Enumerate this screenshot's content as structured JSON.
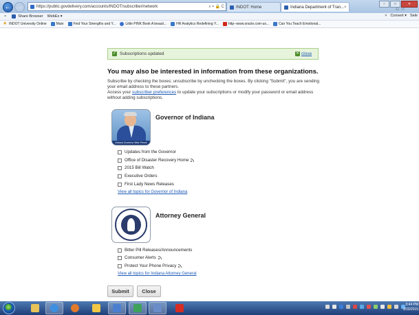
{
  "browser": {
    "url": "https://public.govdelivery.com/accounts/INDOT/subscriber/network",
    "url_controls": "⌕ ▾ 🔒 C",
    "tabs": [
      {
        "label": "INDOT: Home",
        "active": false
      },
      {
        "label": "Indiana Department of Tran...",
        "active": true
      }
    ],
    "tab_close": "×"
  },
  "command_bar": {
    "close": "×",
    "items": [
      "Share Browser",
      "WebEx ▾"
    ],
    "right_items": [
      "×",
      "Convert ▾",
      "Sele"
    ]
  },
  "favorites": [
    {
      "label": "INDOT University Online",
      "icon": "star"
    },
    {
      "label": "Main",
      "icon": "ie"
    },
    {
      "label": "Find Your Strengths and Y...",
      "icon": "ie"
    },
    {
      "label": "Little PINK Book  A beauti...",
      "icon": "pink"
    },
    {
      "label": "HR Analytics Redefining Y...",
      "icon": "ie"
    },
    {
      "label": "http--www.oracle.com-us...",
      "icon": "oracle"
    },
    {
      "label": "Can You Teach Emotional...",
      "icon": "ie"
    }
  ],
  "alert": {
    "message": "Subscriptions updated",
    "close_label": "close"
  },
  "heading": "You may also be interested in information from these organizations.",
  "intro": {
    "line1": "Subscribe by checking the boxes; unsubscribe by unchecking the boxes. By clicking \"Submit\", you are sending your email address to these partners.",
    "line2_pre": "Access your ",
    "line2_link": "subscriber preferences",
    "line2_post": " to update your subscriptions or modify your password or email address without adding subscriptions."
  },
  "organizations": [
    {
      "name": "Governor of Indiana",
      "logo_caption": "Indiana Governor Mike Pence",
      "topics": [
        {
          "label": "Updates from the Governor",
          "rss": false
        },
        {
          "label": "Office of Disaster Recovery Home",
          "rss": true
        },
        {
          "label": "2015 Bill Watch",
          "rss": false
        },
        {
          "label": "Executive Orders",
          "rss": false
        },
        {
          "label": "First Lady News Releases",
          "rss": false
        }
      ],
      "view_all": "View all topics for Governor of Indiana"
    },
    {
      "name": "Attorney General",
      "topics": [
        {
          "label": "Bitter Pill Releases/Announcements",
          "rss": false
        },
        {
          "label": "Consumer Alerts",
          "rss": true
        },
        {
          "label": "Protect Your Phone Privacy",
          "rss": true
        }
      ],
      "view_all": "View all topics for Indiana Attorney General"
    }
  ],
  "buttons": {
    "submit": "Submit",
    "close": "Close"
  },
  "taskbar": {
    "clock_time": "3:44 PM",
    "clock_date": "3/30/2015"
  },
  "colors": {
    "link": "#1a57b5",
    "alert_bg": "#e7f4dc",
    "taskbar": "#1f3e78"
  }
}
